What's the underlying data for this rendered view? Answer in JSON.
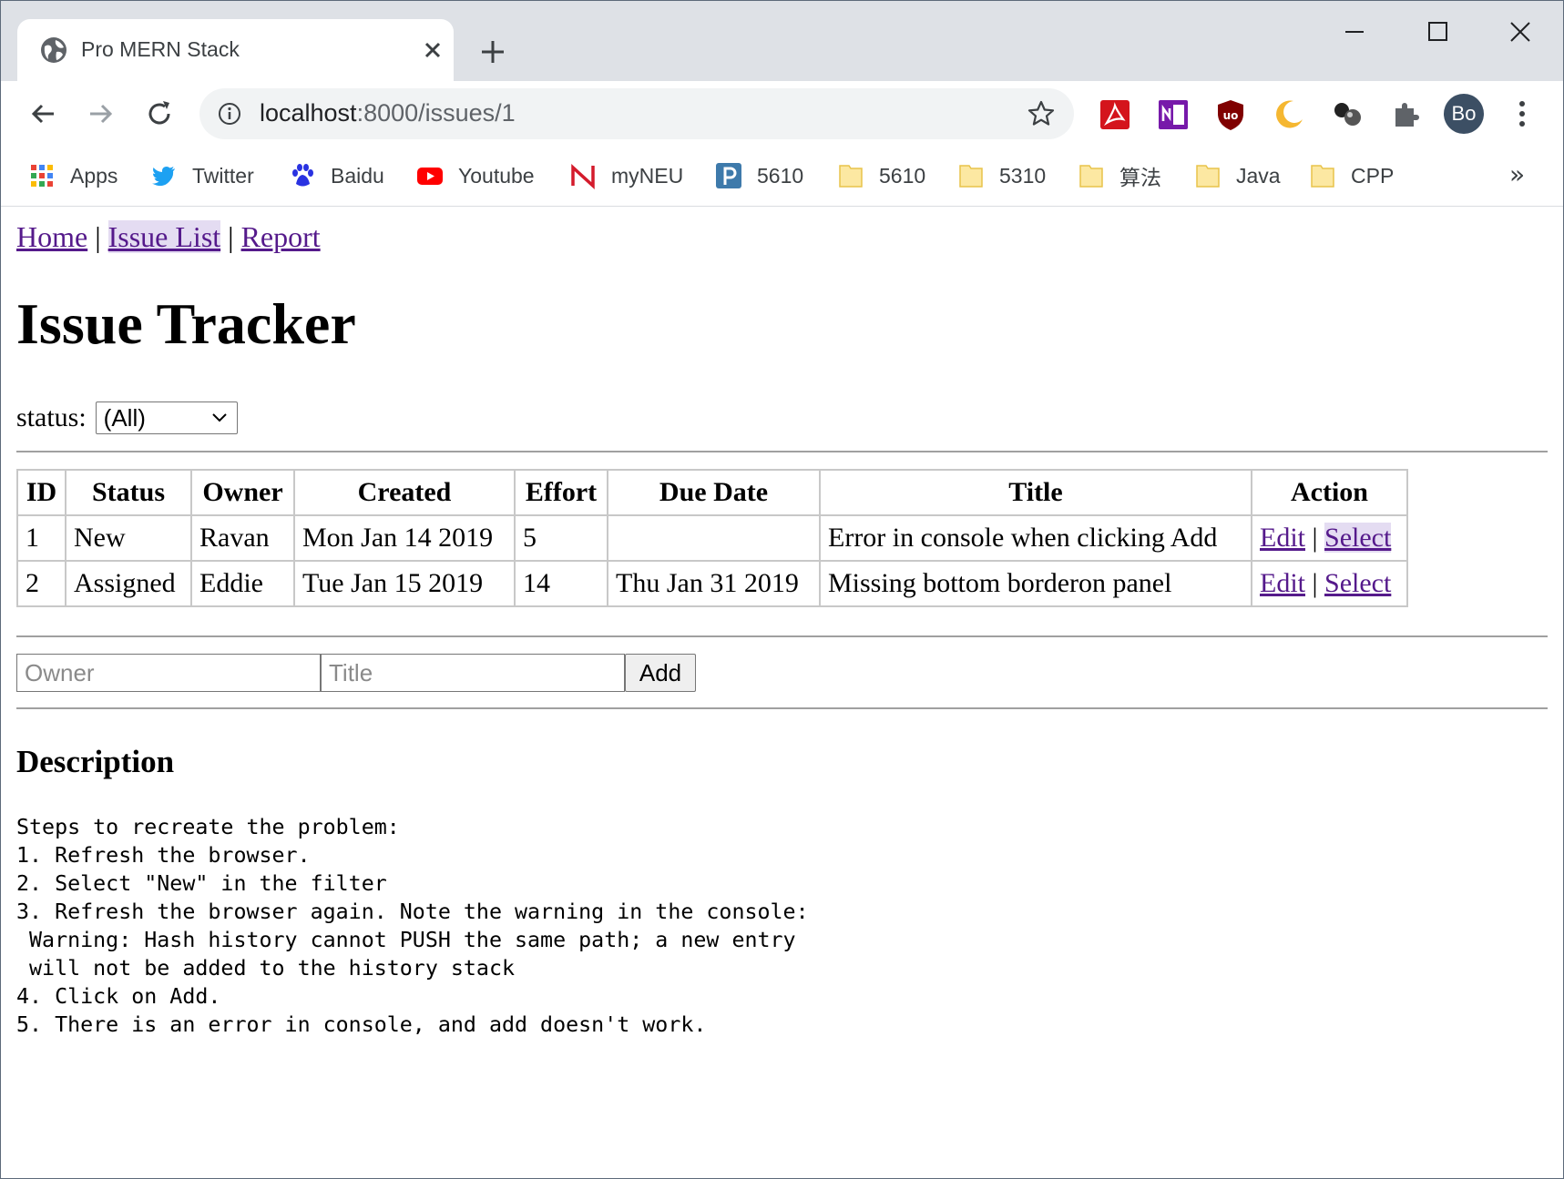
{
  "browser": {
    "tab_title": "Pro MERN Stack",
    "url_host": "localhost",
    "url_path": ":8000/issues/1",
    "profile_initials": "Bo",
    "bookmarks": [
      {
        "label": "Apps",
        "icon": "apps-grid-icon"
      },
      {
        "label": "Twitter",
        "icon": "twitter-icon"
      },
      {
        "label": "Baidu",
        "icon": "baidu-icon"
      },
      {
        "label": "Youtube",
        "icon": "youtube-icon"
      },
      {
        "label": "myNEU",
        "icon": "myneu-icon"
      },
      {
        "label": "5610",
        "icon": "piazza-icon"
      },
      {
        "label": "5610",
        "icon": "folder-icon"
      },
      {
        "label": "5310",
        "icon": "folder-icon"
      },
      {
        "label": "算法",
        "icon": "folder-icon"
      },
      {
        "label": "Java",
        "icon": "folder-icon"
      },
      {
        "label": "CPP",
        "icon": "folder-icon"
      }
    ],
    "more_bookmarks": "»"
  },
  "nav": {
    "home": "Home",
    "issue_list": "Issue List",
    "report": "Report",
    "separator": "|"
  },
  "heading": "Issue Tracker",
  "filter": {
    "label": "status:",
    "selected": "(All)"
  },
  "table": {
    "headers": [
      "ID",
      "Status",
      "Owner",
      "Created",
      "Effort",
      "Due Date",
      "Title",
      "Action"
    ],
    "rows": [
      {
        "id": "1",
        "status": "New",
        "owner": "Ravan",
        "created": "Mon Jan 14 2019",
        "effort": "5",
        "due": "",
        "title": "Error in console when clicking Add",
        "edit": "Edit",
        "sep": "|",
        "select": "Select"
      },
      {
        "id": "2",
        "status": "Assigned",
        "owner": "Eddie",
        "created": "Tue Jan 15 2019",
        "effort": "14",
        "due": "Thu Jan 31 2019",
        "title": "Missing bottom borderon panel",
        "edit": "Edit",
        "sep": "|",
        "select": "Select"
      }
    ]
  },
  "add_form": {
    "owner_placeholder": "Owner",
    "title_placeholder": "Title",
    "add_label": "Add"
  },
  "description": {
    "title": "Description",
    "text": "Steps to recreate the problem:\n1. Refresh the browser.\n2. Select \"New\" in the filter\n3. Refresh the browser again. Note the warning in the console:\n Warning: Hash history cannot PUSH the same path; a new entry\n will not be added to the history stack\n4. Click on Add.\n5. There is an error in console, and add doesn't work."
  }
}
